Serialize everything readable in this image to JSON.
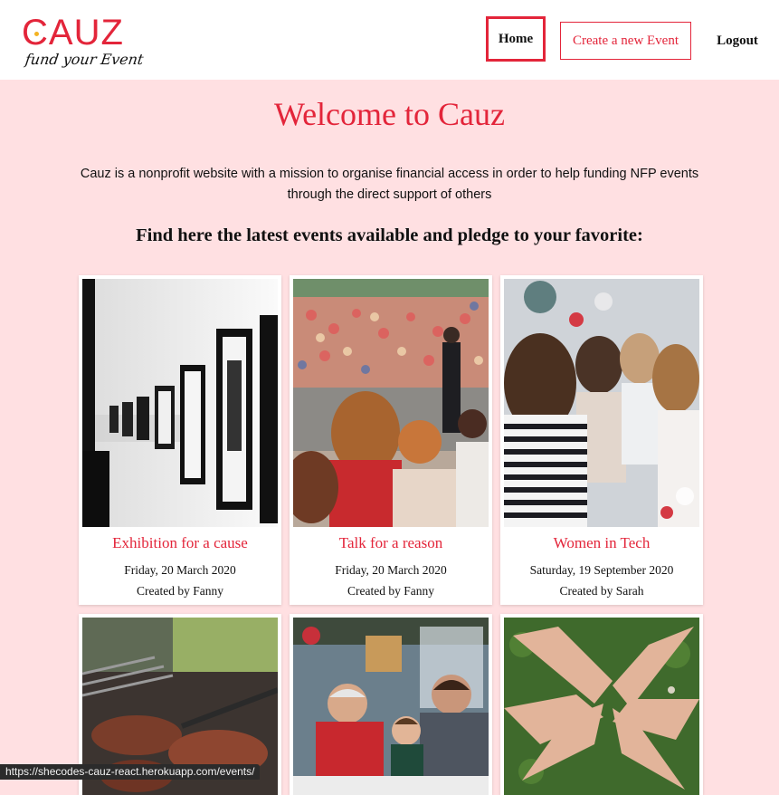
{
  "logo": {
    "main": "CAUZ",
    "tagline": "fund your Event"
  },
  "nav": {
    "home": "Home",
    "create": "Create a new Event",
    "logout": "Logout"
  },
  "main": {
    "title": "Welcome to Cauz",
    "intro_line1": "Cauz is a nonprofit website with a mission to organise financial access in order to help funding NFP events",
    "intro_line2": "through the direct support of others",
    "subheading": "Find here the latest events available and pledge to your favorite:"
  },
  "events": [
    {
      "title": "Exhibition for a cause",
      "date": "Friday, 20 March 2020",
      "author": "Created by Fanny"
    },
    {
      "title": "Talk for a reason",
      "date": "Friday, 20 March 2020",
      "author": "Created by Fanny"
    },
    {
      "title": "Women in Tech",
      "date": "Saturday, 19 September 2020",
      "author": "Created by Sarah"
    }
  ],
  "status_url": "https://shecodes-cauz-react.herokuapp.com/events/",
  "colors": {
    "accent": "#e3253a",
    "page_bg": "#ffe0e2",
    "gold": "#f3b323"
  }
}
